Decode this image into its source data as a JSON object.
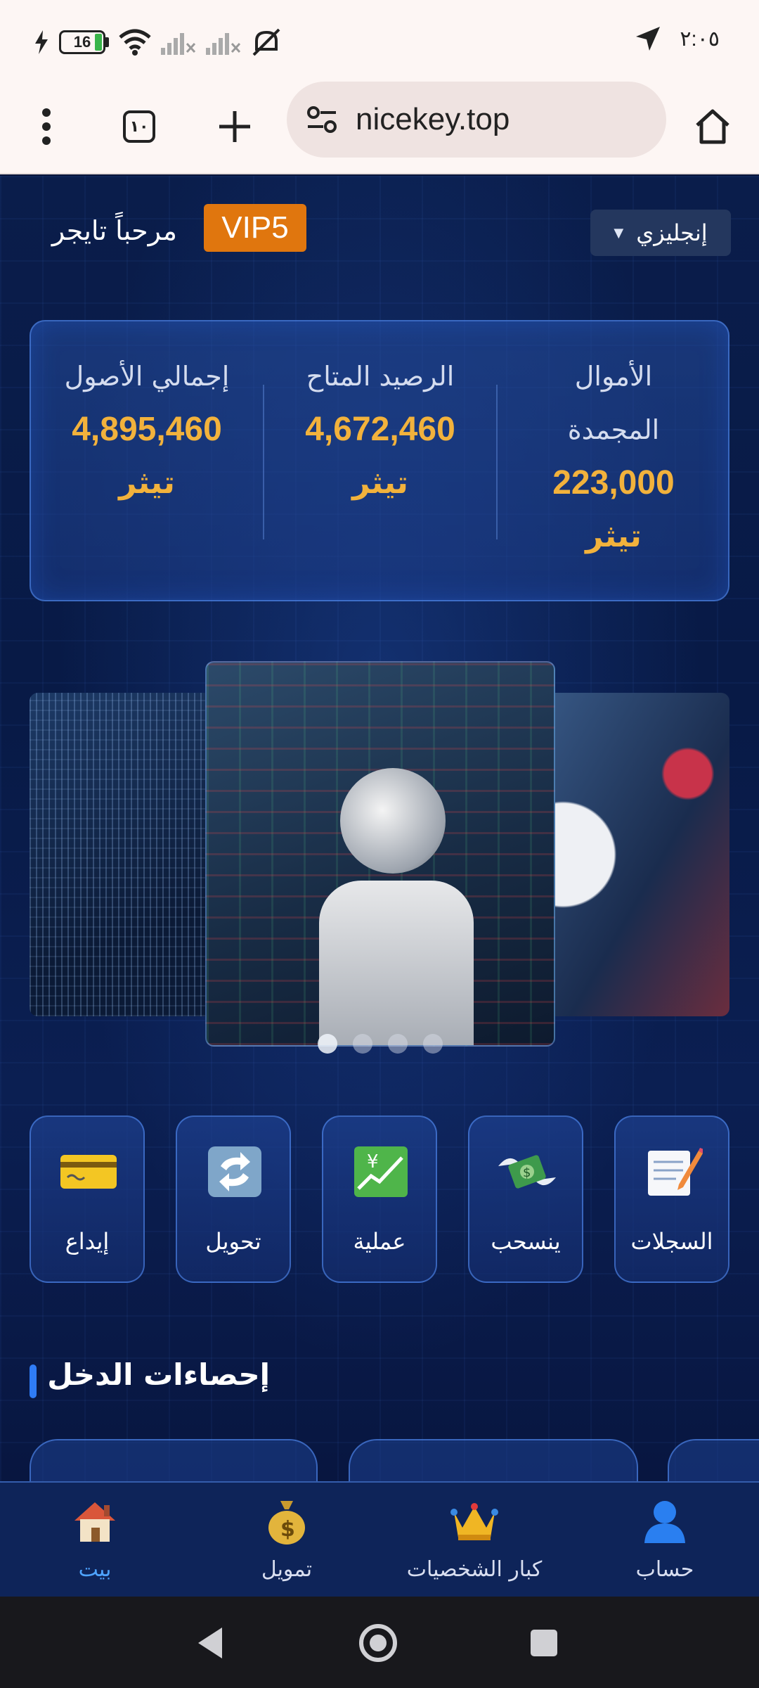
{
  "status_bar": {
    "battery_level": "16",
    "time": "٢:٠٥",
    "icons": [
      "charging-icon",
      "battery-icon",
      "wifi-icon",
      "signal-1-icon",
      "signal-2-icon",
      "mute-icon",
      "location-icon"
    ]
  },
  "browser": {
    "url": "nicekey.top",
    "tab_count": "١٠",
    "icons": [
      "menu-dots-icon",
      "tabs-icon",
      "new-tab-icon",
      "site-settings-icon",
      "home-icon"
    ]
  },
  "header": {
    "welcome": "مرحباً تايجر",
    "vip_badge": "VIP5",
    "language": "إنجليزي"
  },
  "assets": {
    "total_label": "إجمالي الأصول",
    "total_value": "4,895,460",
    "available_label": "الرصيد المتاح",
    "available_value": "4,672,460",
    "frozen_label_line1": "الأموال",
    "frozen_label_line2": "المجمدة",
    "frozen_value": "223,000",
    "unit": "تيثر"
  },
  "carousel": {
    "slide_count": 4,
    "active_index": 0
  },
  "actions": [
    {
      "label": "إيداع",
      "icon": "credit-card-icon"
    },
    {
      "label": "تحويل",
      "icon": "exchange-icon"
    },
    {
      "label": "عملية",
      "icon": "chart-yen-icon"
    },
    {
      "label": "ينسحب",
      "icon": "flying-money-icon"
    },
    {
      "label": "السجلات",
      "icon": "memo-icon"
    }
  ],
  "income_section": {
    "title": "إحصاءات الدخل"
  },
  "bottom_nav": [
    {
      "label": "بيت",
      "icon": "house-icon",
      "active": true
    },
    {
      "label": "تمويل",
      "icon": "money-bag-icon",
      "active": false
    },
    {
      "label": "كبار الشخصيات",
      "icon": "crown-icon",
      "active": false
    },
    {
      "label": "حساب",
      "icon": "user-icon",
      "active": false
    }
  ],
  "colors": {
    "accent_gold": "#f2b23c",
    "vip_orange": "#e0760e",
    "active_blue": "#4ea4ff",
    "background": "#081a46"
  }
}
